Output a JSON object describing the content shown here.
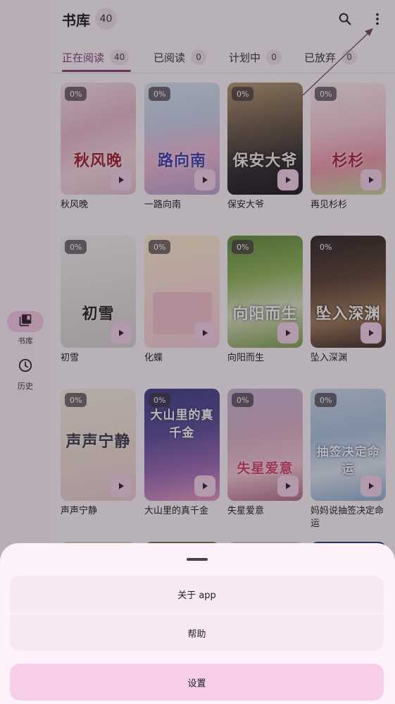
{
  "rail": {
    "items": [
      {
        "label": "书库",
        "icon": "library-books-icon",
        "active": true
      },
      {
        "label": "历史",
        "icon": "history-clock-icon",
        "active": false
      }
    ]
  },
  "header": {
    "title": "书库",
    "count": "40"
  },
  "tabs": [
    {
      "label": "正在阅读",
      "count": "40",
      "active": true
    },
    {
      "label": "已阅读",
      "count": "0",
      "active": false
    },
    {
      "label": "计划中",
      "count": "0",
      "active": false
    },
    {
      "label": "已放弃",
      "count": "0",
      "active": false
    }
  ],
  "books": [
    {
      "title": "秋风晚",
      "progress": "0%",
      "cover_text": "秋风晚"
    },
    {
      "title": "一路向南",
      "progress": "0%",
      "cover_text": "路向南"
    },
    {
      "title": "保安大爷",
      "progress": "0%",
      "cover_text": "保安大爷"
    },
    {
      "title": "再见杉杉",
      "progress": "0%",
      "cover_text": "杉杉"
    },
    {
      "title": "初雪",
      "progress": "0%",
      "cover_text": "初雪"
    },
    {
      "title": "化蝶",
      "progress": "0%",
      "cover_text": ""
    },
    {
      "title": "向阳而生",
      "progress": "0%",
      "cover_text": "向阳而生"
    },
    {
      "title": "坠入深渊",
      "progress": "0%",
      "cover_text": "坠入深渊"
    },
    {
      "title": "声声宁静",
      "progress": "0%",
      "cover_text": "声声宁静"
    },
    {
      "title": "大山里的真千金",
      "progress": "0%",
      "cover_text": "大山里的真千金"
    },
    {
      "title": "失星爱意",
      "progress": "0%",
      "cover_text": "失星爱意"
    },
    {
      "title": "妈妈说抽签决定命运",
      "progress": "0%",
      "cover_text": "抽签决定命运"
    }
  ],
  "sheet": {
    "about": "关于 app",
    "help": "帮助",
    "settings": "设置"
  },
  "colors": {
    "accent": "#8a3f78",
    "sheet_bg": "#fdf2f9",
    "settings_bg": "#f7cdea",
    "scrim": "rgba(40,30,40,0.32)"
  }
}
